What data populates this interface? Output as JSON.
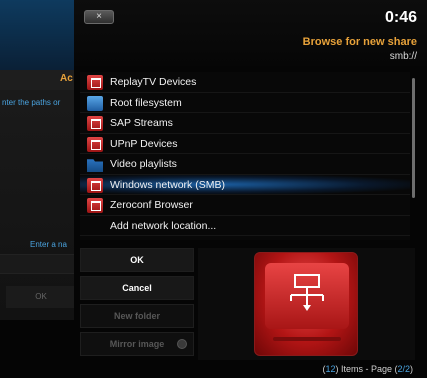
{
  "background_dialog": {
    "title_fragment": "Ac",
    "hint_fragment": "nter the paths or",
    "enter_fragment": "Enter a na",
    "ok_label": "OK"
  },
  "header": {
    "close_label": "×",
    "time": "0:46",
    "heading": "Browse for new share",
    "path": "smb://"
  },
  "list": {
    "items": [
      {
        "label": "ReplayTV Devices",
        "icon": "network-drive-icon",
        "selected": false
      },
      {
        "label": "Root filesystem",
        "icon": "harddisk-icon",
        "selected": false
      },
      {
        "label": "SAP Streams",
        "icon": "network-drive-icon",
        "selected": false
      },
      {
        "label": "UPnP Devices",
        "icon": "network-drive-icon",
        "selected": false
      },
      {
        "label": "Video playlists",
        "icon": "folder-icon",
        "selected": false
      },
      {
        "label": "Windows network (SMB)",
        "icon": "network-drive-icon",
        "selected": true
      },
      {
        "label": "Zeroconf Browser",
        "icon": "network-drive-icon",
        "selected": false
      },
      {
        "label": "Add network location...",
        "icon": "",
        "selected": false
      }
    ]
  },
  "buttons": {
    "ok": "OK",
    "cancel": "Cancel",
    "new_folder": "New folder",
    "mirror_image": "Mirror image"
  },
  "footer": {
    "count": "12",
    "items_text": "Items - Page",
    "page": "2/2"
  },
  "colors": {
    "accent": "#e8a23a",
    "highlight": "#4aa3df",
    "icon_red": "#c42020"
  }
}
